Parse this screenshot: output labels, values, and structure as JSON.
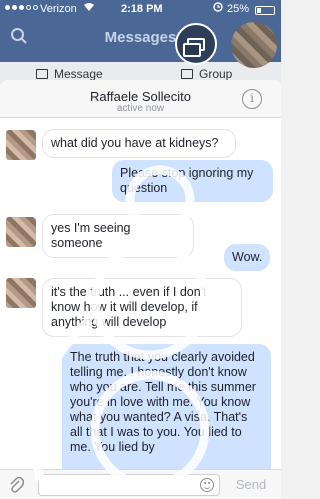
{
  "status_bar": {
    "carrier": "Verizon",
    "time": "2:18 PM",
    "battery": "25%"
  },
  "background": {
    "title": "Messages",
    "tabs": [
      {
        "label": "Message"
      },
      {
        "label": "Group"
      }
    ]
  },
  "chat": {
    "contact_name": "Raffaele Sollecito",
    "status": "active now",
    "messages": [
      {
        "direction": "in",
        "text": "what did you have at kidneys?"
      },
      {
        "direction": "out",
        "text": "Please stop ignoring my question"
      },
      {
        "direction": "in",
        "text": "yes I'm seeing someone"
      },
      {
        "direction": "out",
        "text": "Wow."
      },
      {
        "direction": "in",
        "text": "it's the truth ... even if I don't know how it will develop, if anything will develop"
      },
      {
        "direction": "out",
        "text": "The truth that you clearly avoided telling me. I honestly don't know who you are. Tell me this summer you're in love with me. You know what you wanted? A visa. That's all that I was to you. You lied to me. You lied by"
      }
    ],
    "send_label": "Send"
  },
  "colors": {
    "header_blue": "#4a6796",
    "outgoing_bubble": "#cfe2ff",
    "incoming_bubble": "#ffffff"
  }
}
